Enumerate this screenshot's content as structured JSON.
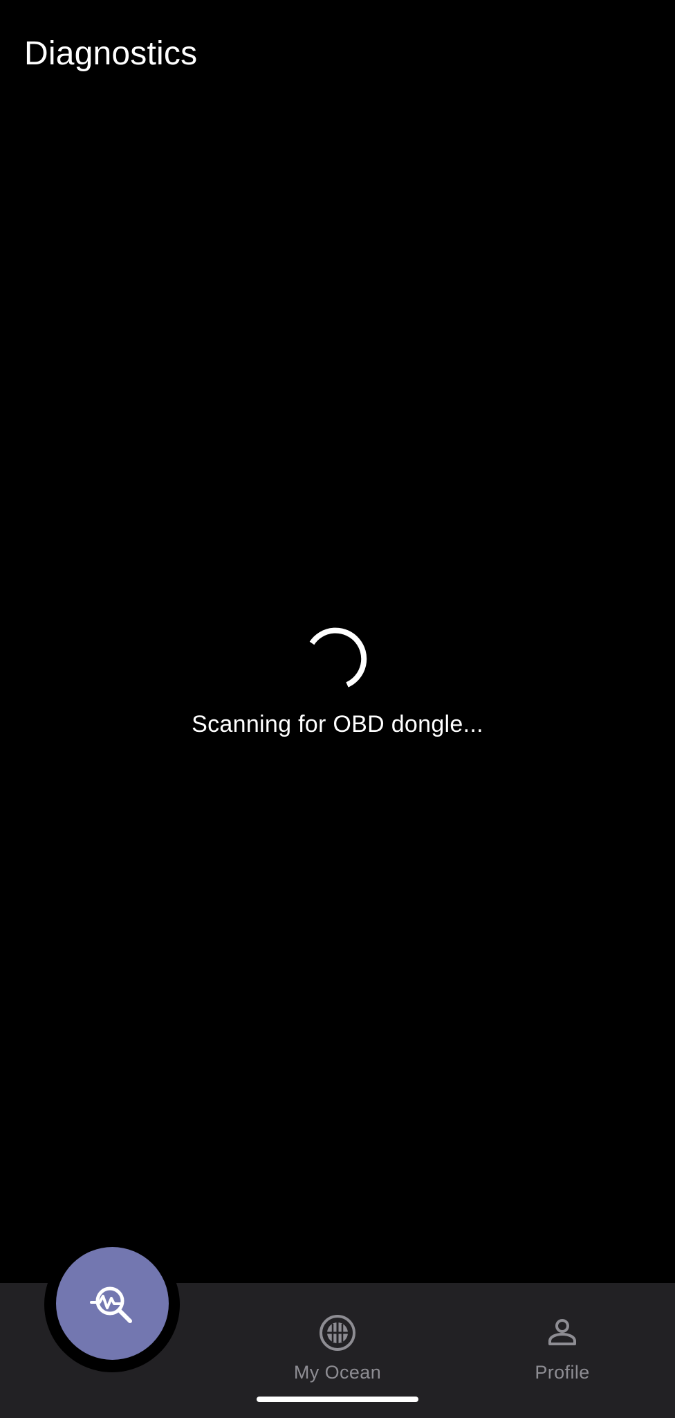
{
  "header": {
    "title": "Diagnostics"
  },
  "status": {
    "message": "Scanning for OBD dongle..."
  },
  "bottom_nav": {
    "fab": {
      "icon": "diagnostics-search-icon",
      "active": true
    },
    "items": [
      {
        "label": "My Ocean",
        "icon": "ocean-globe-icon"
      },
      {
        "label": "Profile",
        "icon": "person-icon"
      }
    ]
  },
  "colors": {
    "background": "#000000",
    "nav_background": "#222124",
    "fab": "#7377b0",
    "nav_label": "#8e8d93",
    "text": "#ffffff"
  }
}
